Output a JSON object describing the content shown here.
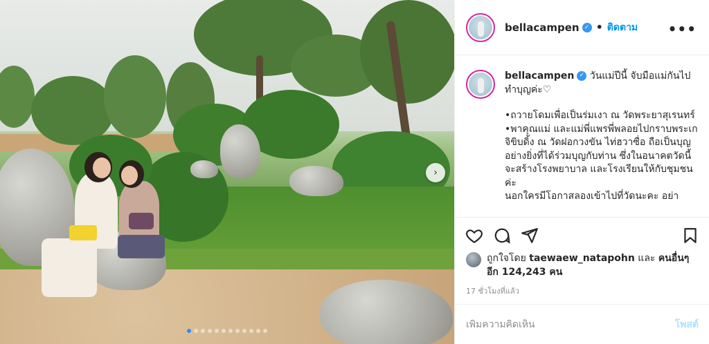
{
  "post": {
    "carousel": {
      "slide_count": 12,
      "active_index": 0
    }
  },
  "header": {
    "username": "bellacampen",
    "separator": "•",
    "follow_label": "ติดตาม",
    "more_label": "•••"
  },
  "caption": {
    "username": "bellacampen",
    "intro": "วันแม่ปีนี้ จับมือแม่กันไปทำบุญค่ะ♡",
    "body": "•ถวายโดมเพื่อเป็นร่มเงา ณ วัดพระยาสุเรนทร์\n•พาคุณแม่ และแม่พี่แพรพี่พลอยไปกราบพระเกจิขิบดิ้ง ณ วัดฝอกวงขัน ไท่ฮวาซื่อ ถือเป็นบุญอย่างยิ่งที่ได้ร่วมบุญกับท่าน ซึ่งในอนาคตวัดนี้จะสร้างโรงพยาบาล และโรงเรียนให้กับชุมชนค่ะ\nนอกใครมีโอกาสลองเข้าไปที่วัดนะคะ อย่า"
  },
  "likes": {
    "prefix": "ถูกใจโดย",
    "liker": "taewaew_natapohn",
    "conj": "และ",
    "others": "คนอื่นๆ อีก 124,243 คน"
  },
  "timestamp": "17 ชั่วโมงที่แล้ว",
  "comment": {
    "placeholder": "เพิ่มความคิดเห็น",
    "post_label": "โพสต์"
  },
  "colors": {
    "accent": "#0095f6",
    "post_disabled": "#b2dffc",
    "carousel_active": "#2f8bff"
  },
  "icons": [
    "verified-badge-icon",
    "more-options-icon",
    "heart-icon",
    "comment-icon",
    "share-icon",
    "bookmark-icon",
    "chevron-right-icon"
  ]
}
